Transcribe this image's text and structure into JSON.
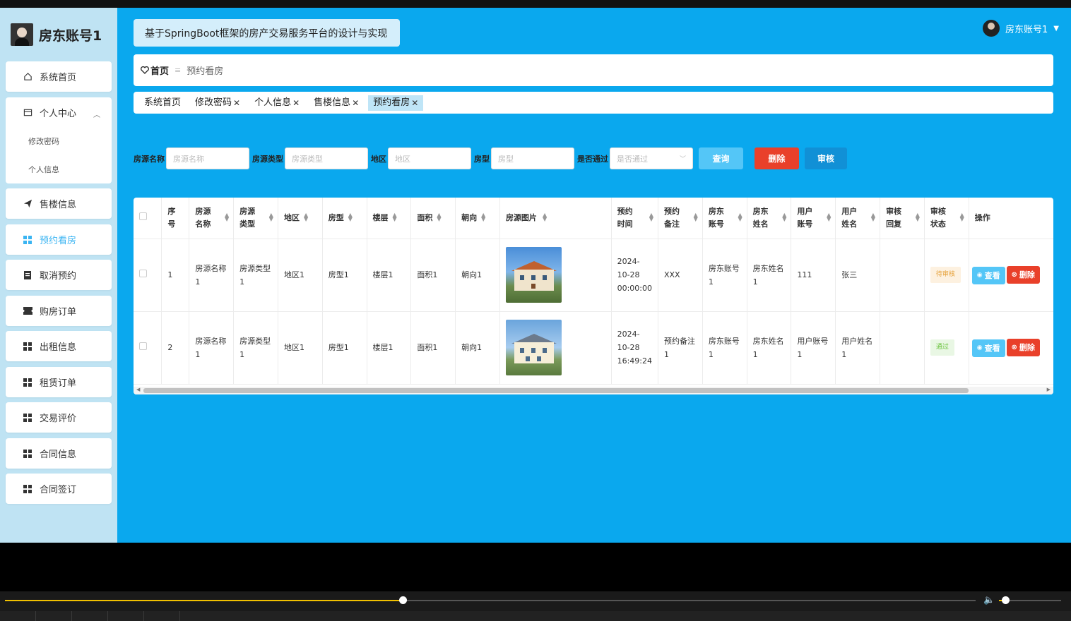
{
  "sidebar": {
    "user_name": "房东账号1",
    "items": [
      {
        "label": "系统首页",
        "icon": "home-icon"
      },
      {
        "label": "个人中心",
        "icon": "user-center-icon"
      },
      {
        "label": "售楼信息",
        "icon": "send-icon"
      },
      {
        "label": "预约看房",
        "icon": "grid-icon"
      },
      {
        "label": "取消预约",
        "icon": "clipboard-icon"
      },
      {
        "label": "购房订单",
        "icon": "ticket-icon"
      },
      {
        "label": "出租信息",
        "icon": "grid-icon"
      },
      {
        "label": "租赁订单",
        "icon": "grid-icon"
      },
      {
        "label": "交易评价",
        "icon": "grid-icon"
      },
      {
        "label": "合同信息",
        "icon": "grid-icon"
      },
      {
        "label": "合同签订",
        "icon": "grid-icon"
      }
    ],
    "sub_items": [
      "修改密码",
      "个人信息"
    ],
    "active": "预约看房"
  },
  "header": {
    "title": "基于SpringBoot框架的房产交易服务平台的设计与实现",
    "user": "房东账号1"
  },
  "breadcrumb": {
    "home": "首页",
    "separator": "≡",
    "current": "预约看房"
  },
  "tabs": [
    {
      "label": "系统首页",
      "closable": false
    },
    {
      "label": "修改密码",
      "closable": true
    },
    {
      "label": "个人信息",
      "closable": true
    },
    {
      "label": "售楼信息",
      "closable": true
    },
    {
      "label": "预约看房",
      "closable": true,
      "active": true
    }
  ],
  "search": {
    "fields": [
      {
        "label": "房源名称",
        "placeholder": "房源名称"
      },
      {
        "label": "房源类型",
        "placeholder": "房源类型"
      },
      {
        "label": "地区",
        "placeholder": "地区"
      },
      {
        "label": "房型",
        "placeholder": "房型"
      }
    ],
    "select": {
      "label": "是否通过",
      "placeholder": "是否通过"
    },
    "query_label": "查询",
    "delete_label": "删除",
    "audit_label": "审核"
  },
  "table": {
    "headers": [
      {
        "l1": "序号",
        "l2": "",
        "sortable": false
      },
      {
        "l1": "房源",
        "l2": "名称",
        "sortable": true
      },
      {
        "l1": "房源",
        "l2": "类型",
        "sortable": true
      },
      {
        "l1": "地区",
        "l2": "",
        "sortable": true
      },
      {
        "l1": "房型",
        "l2": "",
        "sortable": true
      },
      {
        "l1": "楼层",
        "l2": "",
        "sortable": true
      },
      {
        "l1": "面积",
        "l2": "",
        "sortable": true
      },
      {
        "l1": "朝向",
        "l2": "",
        "sortable": true
      },
      {
        "l1": "房源图片",
        "l2": "",
        "sortable": true
      },
      {
        "l1": "预约",
        "l2": "时间",
        "sortable": true
      },
      {
        "l1": "预约",
        "l2": "备注",
        "sortable": true
      },
      {
        "l1": "房东",
        "l2": "账号",
        "sortable": true
      },
      {
        "l1": "房东",
        "l2": "姓名",
        "sortable": true
      },
      {
        "l1": "用户",
        "l2": "账号",
        "sortable": true
      },
      {
        "l1": "用户",
        "l2": "姓名",
        "sortable": true
      },
      {
        "l1": "审核",
        "l2": "回复",
        "sortable": true
      },
      {
        "l1": "审核",
        "l2": "状态",
        "sortable": true
      },
      {
        "l1": "操作",
        "l2": "",
        "sortable": false
      }
    ],
    "rows": [
      {
        "index": "1",
        "name": "房源名称1",
        "type": "房源类型1",
        "region": "地区1",
        "layout": "房型1",
        "floor": "楼层1",
        "area": "面积1",
        "orientation": "朝向1",
        "time": "2024-10-28 00:00:00",
        "note": "XXX",
        "owner_account": "房东账号1",
        "owner_name": "房东姓名1",
        "user_account": "111",
        "user_name": "张三",
        "reply": "",
        "status": "待审核"
      },
      {
        "index": "2",
        "name": "房源名称1",
        "type": "房源类型1",
        "region": "地区1",
        "layout": "房型1",
        "floor": "楼层1",
        "area": "面积1",
        "orientation": "朝向1",
        "time": "2024-10-28 16:49:24",
        "note": "预约备注1",
        "owner_account": "房东账号1",
        "owner_name": "房东姓名1",
        "user_account": "用户账号1",
        "user_name": "用户姓名1",
        "reply": "",
        "status": "通过"
      }
    ],
    "view_label": "查看",
    "delete_label": "删除"
  },
  "player": {
    "progress": 0.41,
    "volume": 0.1
  },
  "colors": {
    "accent": "#0aa8ee",
    "danger": "#e9402a",
    "primary": "#1190d6",
    "sidebar": "#bfe3f3"
  }
}
